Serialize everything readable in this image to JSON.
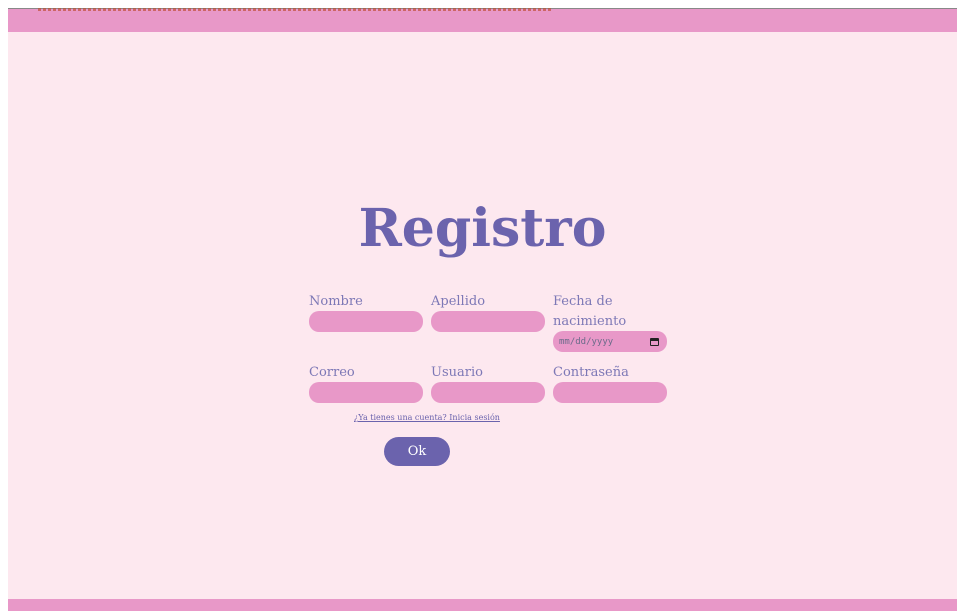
{
  "page": {
    "title": "Registro"
  },
  "form": {
    "nombre": {
      "label": "Nombre",
      "value": ""
    },
    "apellido": {
      "label": "Apellido",
      "value": ""
    },
    "fecha": {
      "label_line1": "Fecha de",
      "label_line2": "nacimiento",
      "placeholder": "mm/dd/yyyy"
    },
    "correo": {
      "label": "Correo",
      "value": ""
    },
    "usuario": {
      "label": "Usuario",
      "value": ""
    },
    "contrasena": {
      "label": "Contraseña",
      "value": ""
    }
  },
  "login_link": "¿Ya tienes una cuenta? Inicia sesión",
  "submit_label": "Ok",
  "colors": {
    "background": "#fde8ef",
    "bar": "#e898c8",
    "accent": "#6b63ad",
    "input": "#e898c8",
    "label": "#7d78b6"
  },
  "icons": {
    "date_picker": "calendar-icon"
  }
}
